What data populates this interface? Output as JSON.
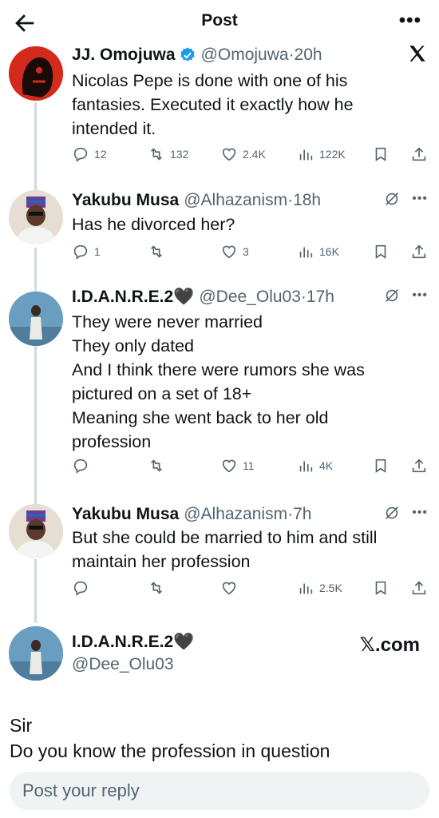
{
  "header": {
    "title": "Post"
  },
  "tweets": [
    {
      "name": "JJ. Omojuwa",
      "handle": "@Omojuwa",
      "time": "·20h",
      "text": "Nicolas Pepe is done with one of his\nfantasies. Executed it exactly how he\nintended it.",
      "replies": "12",
      "reposts": "132",
      "likes": "2.4K",
      "views": "122K"
    },
    {
      "name": "Yakubu Musa",
      "handle": "@Alhazanism",
      "time": "·18h",
      "text": "Has he divorced her?",
      "replies": "1",
      "reposts": "",
      "likes": "3",
      "views": "16K"
    },
    {
      "name": "I.D.A.N.R.E.2🖤",
      "handle": "@Dee_Olu03",
      "time": "·17h",
      "text": "They were never married\nThey only dated\nAnd I think there were rumors she was\npictured on a set of 18+\nMeaning she went back to her old\nprofession",
      "replies": "",
      "reposts": "",
      "likes": "11",
      "views": "4K"
    },
    {
      "name": "Yakubu Musa",
      "handle": "@Alhazanism",
      "time": "·7h",
      "text": "But she could be married to him and still\nmaintain her profession",
      "replies": "",
      "reposts": "",
      "likes": "",
      "views": "2.5K"
    }
  ],
  "card": {
    "name": "I.D.A.N.R.E.2🖤",
    "handle": "@Dee_Olu03",
    "brand": "𝕏.com",
    "text_line1": "Sir",
    "text_line2": "Do you know the profession in question"
  },
  "reply": {
    "placeholder": "Post your reply"
  },
  "colors": {
    "text": "#0f1419",
    "secondary": "#536471",
    "verified": "#1d9bf0",
    "line": "#cfd9de",
    "input_bg": "#eff3f4"
  }
}
